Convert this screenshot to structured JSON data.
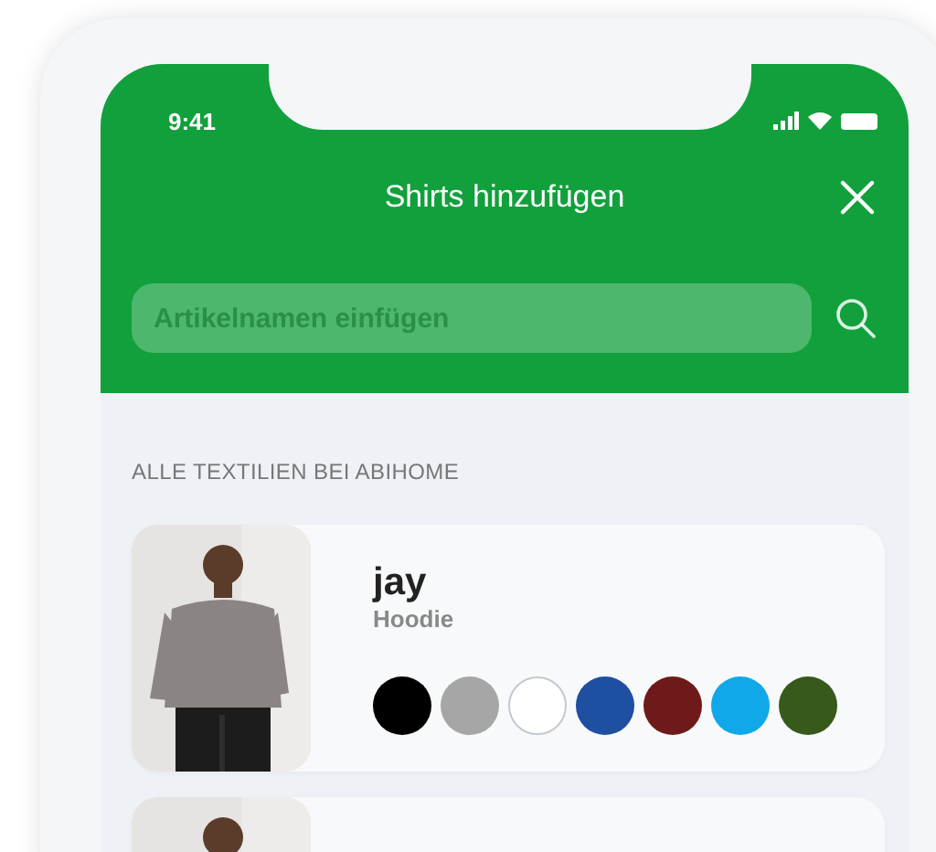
{
  "status_bar": {
    "time": "9:41"
  },
  "header": {
    "title": "Shirts hinzufügen"
  },
  "search": {
    "placeholder": "Artikelnamen einfügen"
  },
  "section": {
    "title": "ALLE TEXTILIEN BEI ABIHOME"
  },
  "products": [
    {
      "name": "jay",
      "type": "Hoodie",
      "picture": {
        "kind": "picture"
      },
      "colors": [
        {
          "color": "#000000"
        },
        {
          "color": "#a6a6a6"
        },
        {
          "color": "#ffffff"
        },
        {
          "color": "#1e4fa0"
        },
        {
          "color": "#6e1a1a"
        },
        {
          "color": "#10a8e8"
        },
        {
          "color": "#37591c"
        }
      ]
    },
    {
      "picture": {
        "kind": "picture"
      }
    }
  ]
}
